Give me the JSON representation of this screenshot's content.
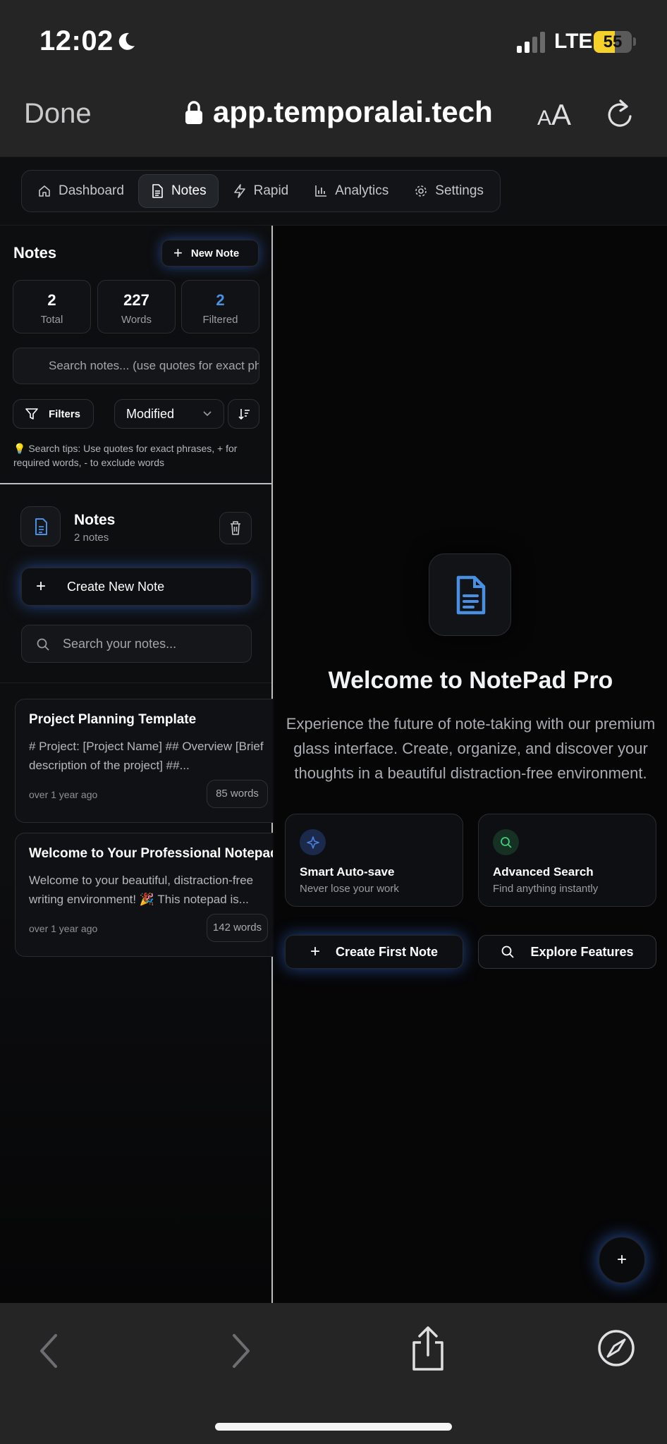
{
  "status_bar": {
    "time": "12:02",
    "network": "LTE",
    "battery": "55",
    "battery_level": 0.55,
    "icons": [
      "moon-icon",
      "signal-icon"
    ]
  },
  "browser": {
    "done_label": "Done",
    "url": "app.temporalai.tech",
    "text_size_small": "A",
    "text_size_large": "A",
    "icons": [
      "lock-icon",
      "reload-icon"
    ]
  },
  "nav": {
    "tabs": [
      {
        "label": "Dashboard",
        "icon": "home-icon"
      },
      {
        "label": "Notes",
        "icon": "document-icon",
        "active": true
      },
      {
        "label": "Rapid",
        "icon": "bolt-icon"
      },
      {
        "label": "Analytics",
        "icon": "bar-chart-icon"
      },
      {
        "label": "Settings",
        "icon": "gear-icon"
      }
    ]
  },
  "sidebar": {
    "title": "Notes",
    "new_note_label": "New Note",
    "stats": [
      {
        "value": "2",
        "label": "Total"
      },
      {
        "value": "227",
        "label": "Words"
      },
      {
        "value": "2",
        "label": "Filtered",
        "color": "#4a90e2"
      }
    ],
    "search_placeholder": "Search notes... (use quotes for exact phrases)",
    "filters_label": "Filters",
    "sort_value": "Modified",
    "tips": "💡 Search tips: Use quotes for exact phrases, + for required words, - to exclude words"
  },
  "notes_panel": {
    "title": "Notes",
    "count": "2 notes",
    "create_label": "Create New Note",
    "search_placeholder": "Search your notes...",
    "notes": [
      {
        "title": "Project Planning Template",
        "preview": "# Project: [Project Name] ## Overview [Brief description of the project] ##...",
        "date": "over 1 year ago",
        "words": "85 words"
      },
      {
        "title": "Welcome to Your Professional Notepad",
        "preview": "Welcome to your beautiful, distraction-free writing environment! 🎉 This notepad is...",
        "date": "over 1 year ago",
        "words": "142 words"
      }
    ]
  },
  "main": {
    "hero_title": "Welcome to NotePad Pro",
    "hero_description": "Experience the future of note-taking with our premium glass interface. Create, organize, and discover your thoughts in a beautiful distraction-free environment.",
    "features": [
      {
        "title": "Smart Auto-save",
        "subtitle": "Never lose your work",
        "icon": "sparkle-icon",
        "color": "#4a7fe0"
      },
      {
        "title": "Advanced Search",
        "subtitle": "Find anything instantly",
        "icon": "search-icon",
        "color": "#3ecf7a"
      }
    ],
    "create_first_label": "Create First Note",
    "explore_label": "Explore Features",
    "fab_label": "+"
  },
  "colors": {
    "accent_blue": "#4a90e2",
    "glow": "#366edc",
    "bg": "#0a0a0b"
  }
}
